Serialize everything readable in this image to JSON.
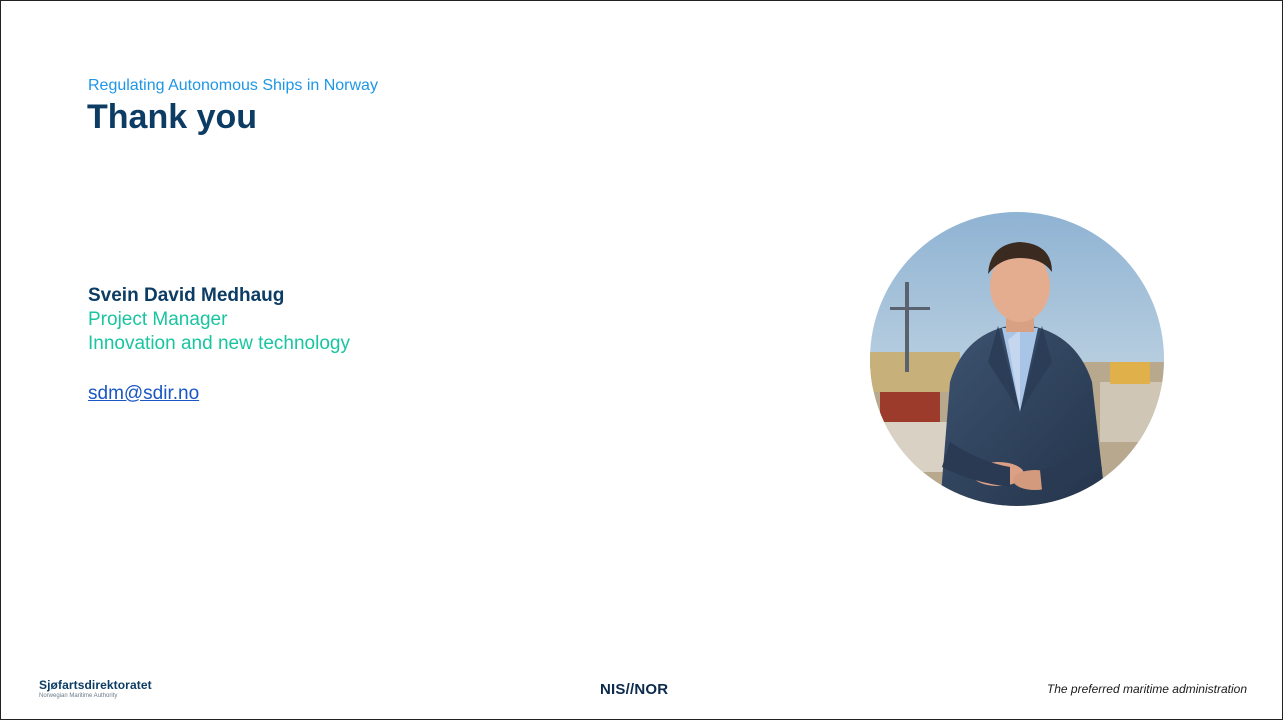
{
  "slide": {
    "subtitle": "Regulating Autonomous Ships in Norway",
    "title": "Thank you"
  },
  "contact": {
    "name": "Svein David Medhaug",
    "role_line_1": "Project Manager",
    "role_line_2": "Innovation and new technology",
    "email": "sdm@sdir.no"
  },
  "footer": {
    "left_logo_name": "Sjøfartsdirektoratet",
    "left_logo_subtitle": "Norwegian Maritime Authority",
    "center_logo": "NIS//NOR",
    "tagline": "The preferred maritime administration"
  },
  "colors": {
    "title": "#0c3c64",
    "subtitle": "#1e96e6",
    "role": "#19c5a0",
    "link": "#1a56c4"
  }
}
